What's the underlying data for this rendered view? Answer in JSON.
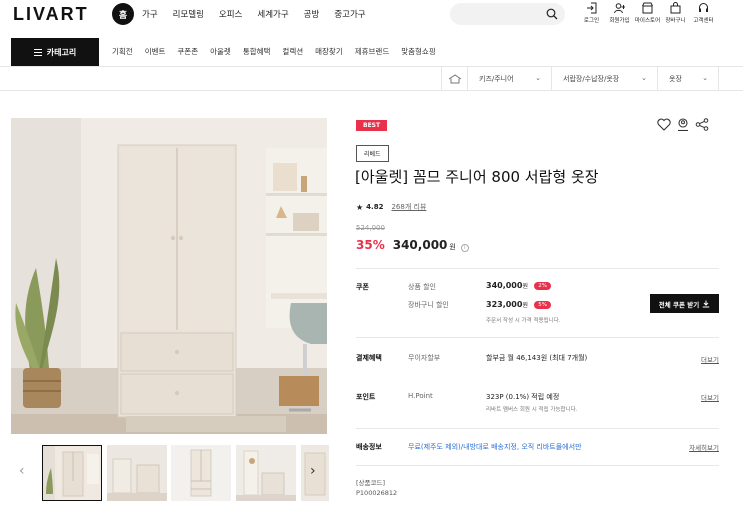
{
  "header": {
    "logo": "LIVART",
    "home_label": "홈",
    "nav": [
      "가구",
      "리모델링",
      "오피스",
      "세계가구",
      "공방",
      "중고가구"
    ],
    "search": {
      "placeholder": ""
    },
    "utils": [
      {
        "icon": "login-icon",
        "label": "로그인"
      },
      {
        "icon": "signup-icon",
        "label": "회원가입"
      },
      {
        "icon": "store-icon",
        "label": "마이스토어"
      },
      {
        "icon": "cart-icon",
        "label": "장바구니"
      },
      {
        "icon": "headset-icon",
        "label": "고객센터"
      }
    ]
  },
  "category_bar": {
    "button_label": "카테고리",
    "items": [
      "기획전",
      "이벤트",
      "쿠폰존",
      "아울렛",
      "통합혜택",
      "컬렉션",
      "매장찾기",
      "제휴브랜드",
      "맞춤형쇼핑"
    ]
  },
  "breadcrumb": {
    "home_icon": "home-icon",
    "items": [
      "키즈/주니어",
      "서랍장/수납장/옷장",
      "옷장"
    ]
  },
  "product": {
    "badge": "BEST",
    "tag": "리베드",
    "title": "[아울렛] 꼼므 주니어 800 서랍형 옷장",
    "rating": "4.82",
    "review_count": "268개 리뷰",
    "original_price": "524,000",
    "discount": "35%",
    "price": "340,000",
    "currency": "원",
    "action_icons": [
      "heart-icon",
      "user-like-icon",
      "share-icon"
    ]
  },
  "coupon": {
    "label": "쿠폰",
    "lines": [
      {
        "sub": "상품 할인",
        "value": "340,000",
        "unit": "원",
        "pct": "2%"
      },
      {
        "sub": "장바구니 할인",
        "value": "323,000",
        "unit": "원",
        "pct": "5%"
      }
    ],
    "note": "주문서 작성 시 가격 적용됩니다.",
    "button": "전체 쿠폰 받기"
  },
  "benefit": {
    "label": "결제혜택",
    "sub": "무이자할부",
    "value": "할부금 월 46,143원 (최대 7개월)",
    "more": "더보기"
  },
  "point": {
    "label": "포인트",
    "sub": "H.Point",
    "value": "323P (0.1%) 적립 예정",
    "note": "리바트 멤버스 회원 시 적립 가능합니다.",
    "more": "더보기"
  },
  "shipping": {
    "label": "배송정보",
    "value": "무료(제주도 제외)/내방대로 배송지정, 오직 리바트몰에서만",
    "more": "자세히보기"
  },
  "code": {
    "label": "[상품코드]",
    "value": "P100026812"
  },
  "colors": {
    "accent": "#e8314b",
    "dark": "#111111",
    "link": "#2a6fd6"
  }
}
